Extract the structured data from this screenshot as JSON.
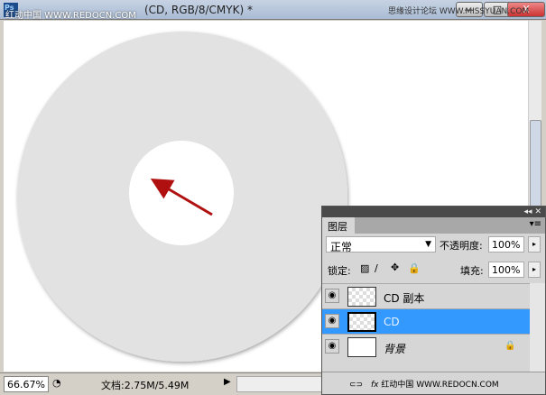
{
  "window": {
    "title": "(CD, RGB/8/CMYK) *",
    "app_icon": "Ps",
    "watermark_left": "红动中国 WWW.REDOCN.COM",
    "watermark_right": "思缘设计论坛 WWW.MISSYUAN.COM",
    "minimize": "—",
    "maximize": "□",
    "close": "X"
  },
  "status": {
    "zoom": "66.67%",
    "doc": "文档:2.75M/5.49M"
  },
  "layers_panel": {
    "tab": "图层",
    "blend_mode": "正常",
    "opacity_label": "不透明度:",
    "opacity": "100%",
    "lock_label": "锁定:",
    "fill_label": "填充:",
    "fill": "100%",
    "layers": [
      {
        "name": "CD 副本",
        "selected": false
      },
      {
        "name": "CD",
        "selected": true
      },
      {
        "name": "背景",
        "selected": false
      }
    ],
    "footer_watermark": "红动中国 WWW.REDOCN.COM"
  },
  "colors": {
    "selection": "#3399ff",
    "arrow": "#b01010"
  }
}
